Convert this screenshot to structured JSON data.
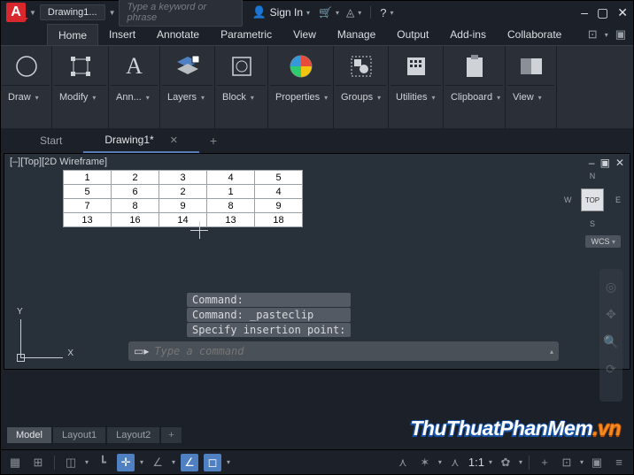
{
  "title": {
    "doc": "Drawing1...",
    "search_placeholder": "Type a keyword or phrase",
    "signin": "Sign In"
  },
  "ribbonTabs": [
    "Home",
    "Insert",
    "Annotate",
    "Parametric",
    "View",
    "Manage",
    "Output",
    "Add-ins",
    "Collaborate"
  ],
  "activeRibbonTab": "Home",
  "panels": [
    {
      "label": "Draw"
    },
    {
      "label": "Modify"
    },
    {
      "label": "Ann..."
    },
    {
      "label": "Layers"
    },
    {
      "label": "Block"
    },
    {
      "label": "Properties"
    },
    {
      "label": "Groups"
    },
    {
      "label": "Utilities"
    },
    {
      "label": "Clipboard"
    },
    {
      "label": "View"
    }
  ],
  "fileTabs": [
    {
      "label": "Start",
      "active": false
    },
    {
      "label": "Drawing1*",
      "active": true
    }
  ],
  "viewport": {
    "label": "[–][Top][2D Wireframe]",
    "navcube": {
      "face": "TOP",
      "n": "N",
      "s": "S",
      "e": "E",
      "w": "W"
    },
    "wcs": "WCS"
  },
  "table": [
    [
      "1",
      "2",
      "3",
      "4",
      "5"
    ],
    [
      "5",
      "6",
      "2",
      "1",
      "4"
    ],
    [
      "7",
      "8",
      "9",
      "8",
      "9"
    ],
    [
      "13",
      "16",
      "14",
      "13",
      "18"
    ]
  ],
  "history": [
    "Command:",
    "Command: _pasteclip",
    "Specify insertion point:"
  ],
  "cmdline": {
    "placeholder": "Type a command"
  },
  "layoutTabs": [
    "Model",
    "Layout1",
    "Layout2"
  ],
  "activeLayoutTab": "Model",
  "status": {
    "scale": "1:1"
  },
  "watermark": {
    "part1": "ThuThuatPhanMem",
    "part2": ".vn"
  }
}
